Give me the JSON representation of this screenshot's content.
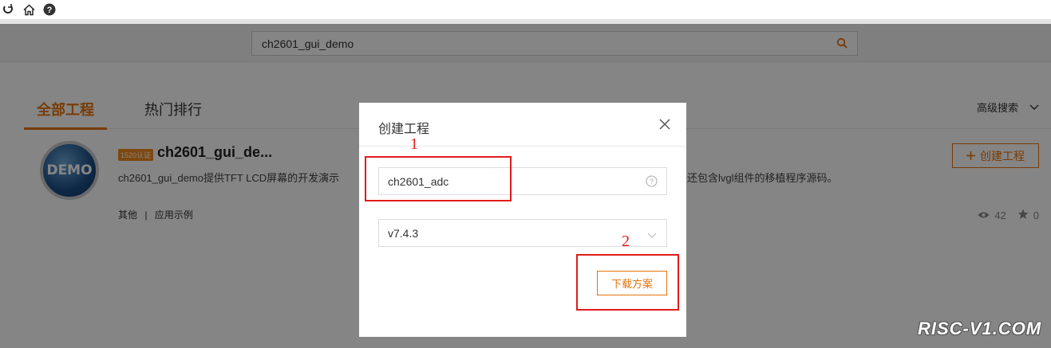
{
  "toolbar": {
    "icons": [
      "refresh-icon",
      "home-icon",
      "help-icon"
    ]
  },
  "search": {
    "value": "ch2601_gui_demo"
  },
  "tabs": [
    {
      "label": "全部工程",
      "active": true
    },
    {
      "label": "热门排行",
      "active": false
    }
  ],
  "advanced_search": "高级搜索",
  "project": {
    "logo_text": "DEMO",
    "badge": "1520认证",
    "title": "ch2601_gui_de...",
    "description": "ch2601_gui_demo提供TFT LCD屏幕的开发演示",
    "description_tail": "内还包含lvgl组件的移植程序源码。",
    "tag_1": "其他",
    "tag_separator": "|",
    "tag_2": "应用示例",
    "create_label": "创建工程",
    "views": "42",
    "stars": "0"
  },
  "dialog": {
    "title": "创建工程",
    "project_name_value": "ch2601_adc",
    "version_value": "v7.4.3",
    "download_label": "下载方案"
  },
  "annotations": {
    "mark_1": "1",
    "mark_2": "2",
    "color": "#e21b1b"
  },
  "colors": {
    "accent": "#e8730a"
  },
  "watermark": "RISC-V1.COM"
}
